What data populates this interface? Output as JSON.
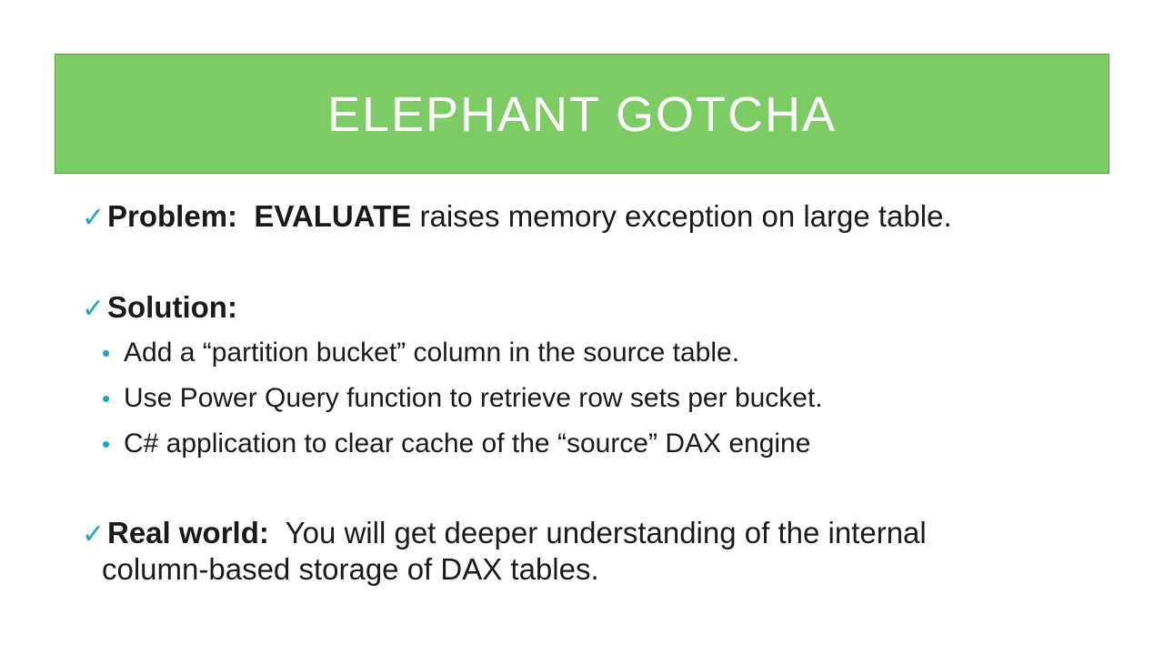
{
  "title": "ELEPHANT GOTCHA",
  "accent_color": "#7dcb65",
  "marker_color": "#1fa0cf",
  "items": [
    {
      "label": "Problem:",
      "emphasis": "EVALUATE",
      "text": " raises memory exception on large table."
    },
    {
      "label": "Solution:",
      "sub_items": [
        "Add a “partition bucket” column in the source table.",
        "Use Power Query function to retrieve row sets per bucket.",
        "C# application to clear cache of the “source” DAX engine"
      ]
    },
    {
      "label": "Real world:",
      "text": "You will get deeper understanding of the internal",
      "continuation": "column-based storage of DAX tables."
    }
  ],
  "check_glyph": "✓",
  "bullet_glyph": "•"
}
